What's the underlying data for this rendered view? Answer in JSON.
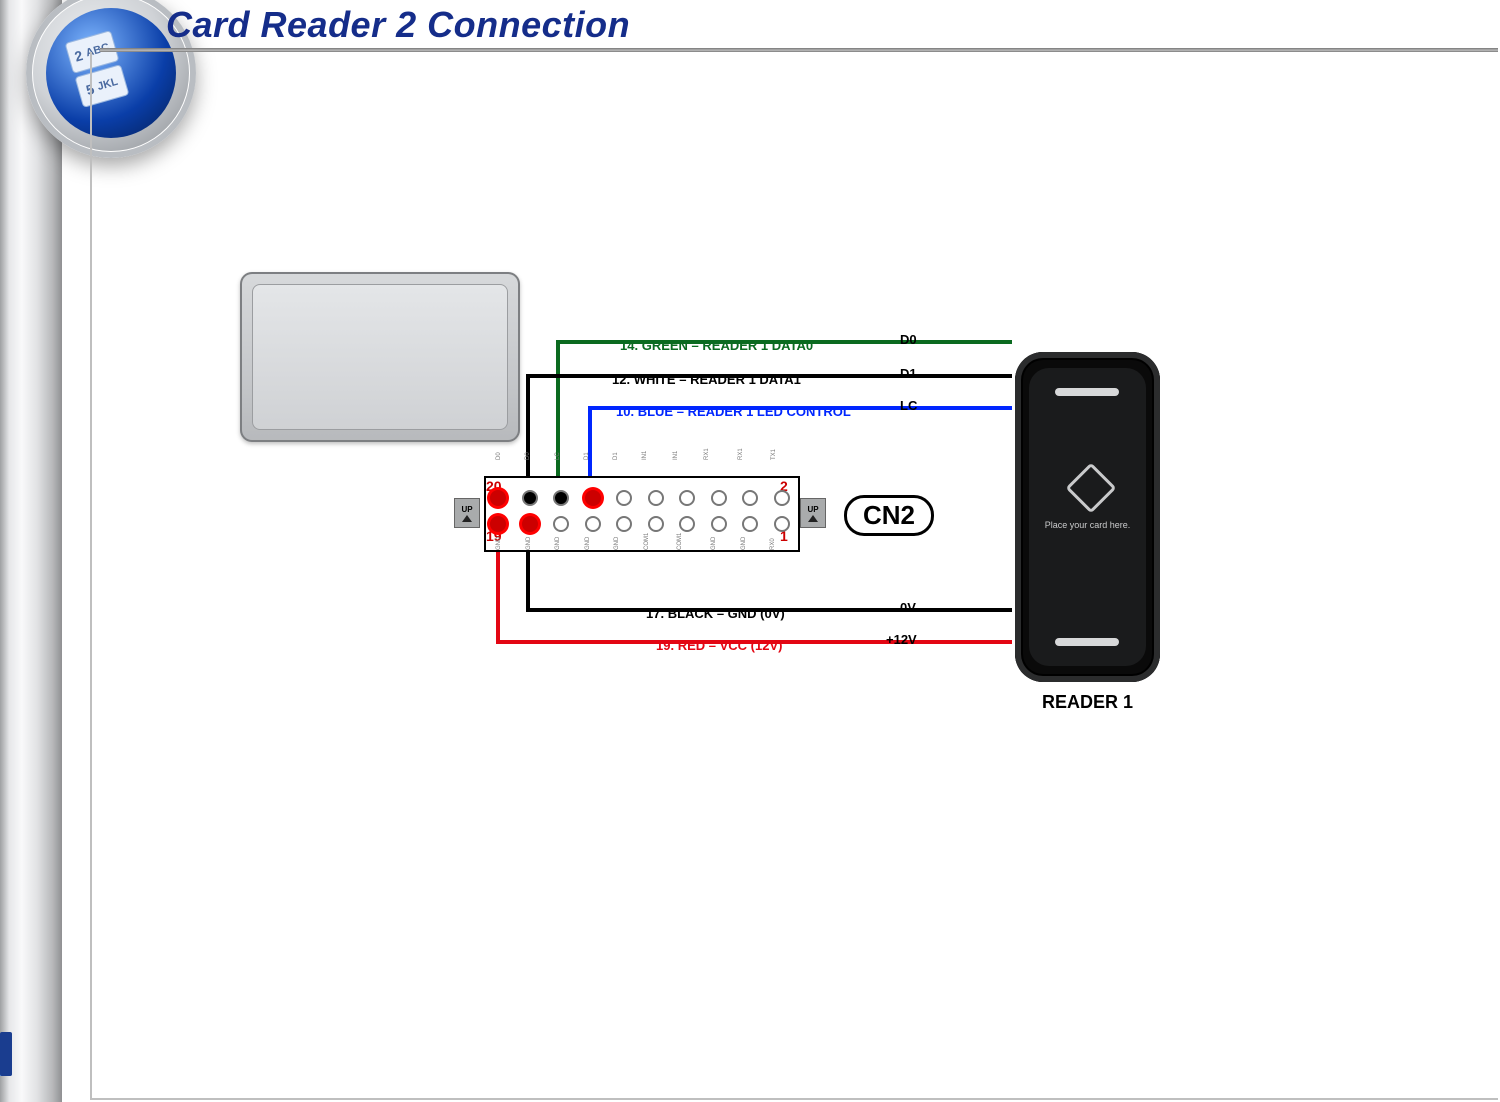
{
  "title": "Card Reader 2 Connection",
  "logo_keys": {
    "k1_num": "2",
    "k1_letters": "ABC",
    "k2_num": "5",
    "k2_letters": "JKL"
  },
  "device_connector_tag": "CN2",
  "connector": {
    "name": "CN2",
    "up": "UP",
    "pins_top_right_to_left": [
      "2",
      "20"
    ],
    "pins_bottom_right_to_left": [
      "1",
      "19"
    ],
    "pin_20": "20",
    "pin_19": "19",
    "pin_2": "2",
    "pin_1": "1",
    "silks_top": [
      "D0",
      "D0",
      "LC",
      "D1",
      "D1",
      "IN1",
      "IN1",
      "RX1",
      "RX1",
      "TX1"
    ],
    "silks_bot": [
      "GND",
      "GND",
      "GND",
      "GND",
      "GND",
      "COM1",
      "COM1",
      "GND",
      "GND",
      "RX0"
    ]
  },
  "wires": [
    {
      "pin": "14",
      "color": "GREEN",
      "desc": "READER 1 DATA0",
      "sig": "D0",
      "css": "green"
    },
    {
      "pin": "12",
      "color": "WHITE",
      "desc": "READER 1 DATA1",
      "sig": "D1",
      "css": "black"
    },
    {
      "pin": "10",
      "color": "BLUE",
      "desc": "READER 1 LED CONTROL",
      "sig": "LC",
      "css": "blue"
    },
    {
      "pin": "17",
      "color": "BLACK",
      "desc": "GND (0V)",
      "sig": "0V",
      "css": "black"
    },
    {
      "pin": "19",
      "color": "RED",
      "desc": "VCC (12V)",
      "sig": "+12V",
      "css": "red"
    }
  ],
  "reader": {
    "name": "READER 1",
    "hint": "Place your card here."
  }
}
